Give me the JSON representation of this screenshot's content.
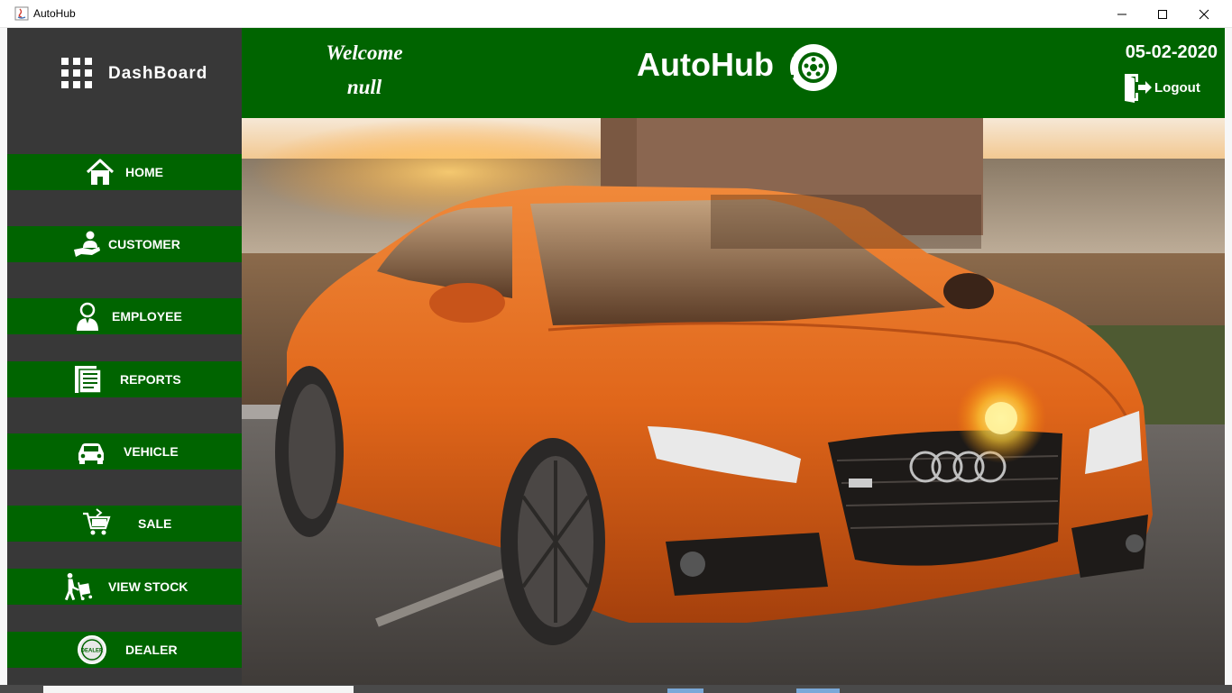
{
  "window": {
    "title": "AutoHub"
  },
  "sidebar": {
    "title": "DashBoard",
    "items": [
      {
        "label": "HOME",
        "icon": "home-icon"
      },
      {
        "label": "CUSTOMER",
        "icon": "customer-icon"
      },
      {
        "label": "EMPLOYEE",
        "icon": "employee-icon"
      },
      {
        "label": "REPORTS",
        "icon": "reports-icon"
      },
      {
        "label": "VEHICLE",
        "icon": "car-icon"
      },
      {
        "label": "SALE",
        "icon": "cart-icon"
      },
      {
        "label": "VIEW STOCK",
        "icon": "stock-trolley-icon"
      },
      {
        "label": "DEALER",
        "icon": "dealer-badge-icon"
      }
    ]
  },
  "header": {
    "welcome_line1": "Welcome",
    "welcome_line2": "null",
    "brand": "AutoHub",
    "date": "05-02-2020",
    "logout_label": "Logout"
  },
  "dealer_badge_text": "DEALER",
  "colors": {
    "accent_green": "#006400",
    "sidebar_dark": "#383838",
    "car_orange": "#e0661a"
  }
}
